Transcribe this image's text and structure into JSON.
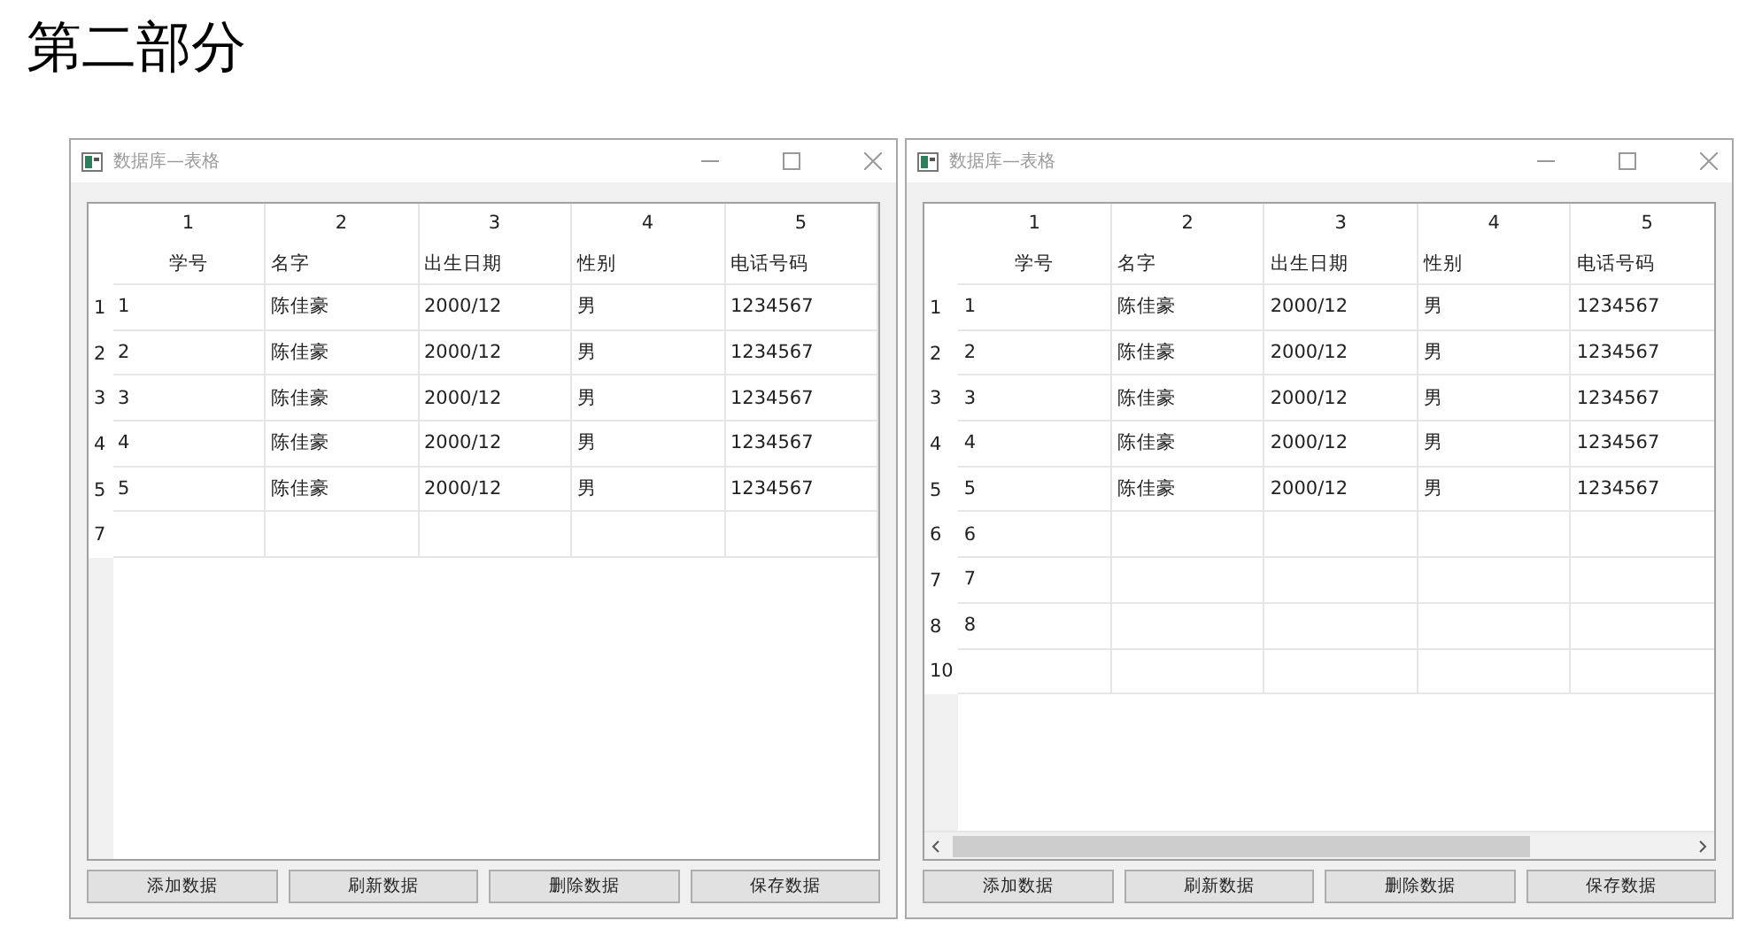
{
  "heading": "第二部分",
  "windows": [
    {
      "title": "数据库—表格",
      "horizontal_scrollbar": false,
      "columns": [
        {
          "number": "1",
          "label": "学号"
        },
        {
          "number": "2",
          "label": "名字"
        },
        {
          "number": "3",
          "label": "出生日期"
        },
        {
          "number": "4",
          "label": "性别"
        },
        {
          "number": "5",
          "label": "电话号码"
        }
      ],
      "rows": [
        {
          "header": "1",
          "cells": [
            "1",
            "陈佳豪",
            "2000/12",
            "男",
            "1234567"
          ]
        },
        {
          "header": "2",
          "cells": [
            "2",
            "陈佳豪",
            "2000/12",
            "男",
            "1234567"
          ]
        },
        {
          "header": "3",
          "cells": [
            "3",
            "陈佳豪",
            "2000/12",
            "男",
            "1234567"
          ]
        },
        {
          "header": "4",
          "cells": [
            "4",
            "陈佳豪",
            "2000/12",
            "男",
            "1234567"
          ]
        },
        {
          "header": "5",
          "cells": [
            "5",
            "陈佳豪",
            "2000/12",
            "男",
            "1234567"
          ]
        },
        {
          "header": "7",
          "cells": []
        }
      ],
      "buttons": [
        "添加数据",
        "刷新数据",
        "删除数据",
        "保存数据"
      ]
    },
    {
      "title": "数据库—表格",
      "horizontal_scrollbar": true,
      "columns": [
        {
          "number": "1",
          "label": "学号"
        },
        {
          "number": "2",
          "label": "名字"
        },
        {
          "number": "3",
          "label": "出生日期"
        },
        {
          "number": "4",
          "label": "性别"
        },
        {
          "number": "5",
          "label": "电话号码"
        }
      ],
      "rows": [
        {
          "header": "1",
          "cells": [
            "1",
            "陈佳豪",
            "2000/12",
            "男",
            "1234567"
          ]
        },
        {
          "header": "2",
          "cells": [
            "2",
            "陈佳豪",
            "2000/12",
            "男",
            "1234567"
          ]
        },
        {
          "header": "3",
          "cells": [
            "3",
            "陈佳豪",
            "2000/12",
            "男",
            "1234567"
          ]
        },
        {
          "header": "4",
          "cells": [
            "4",
            "陈佳豪",
            "2000/12",
            "男",
            "1234567"
          ]
        },
        {
          "header": "5",
          "cells": [
            "5",
            "陈佳豪",
            "2000/12",
            "男",
            "1234567"
          ]
        },
        {
          "header": "6",
          "cells": [
            "6"
          ]
        },
        {
          "header": "7",
          "cells": [
            "7"
          ]
        },
        {
          "header": "8",
          "cells": [
            "8"
          ]
        },
        {
          "header": "10",
          "cells": []
        }
      ],
      "buttons": [
        "添加数据",
        "刷新数据",
        "删除数据",
        "保存数据"
      ]
    }
  ]
}
